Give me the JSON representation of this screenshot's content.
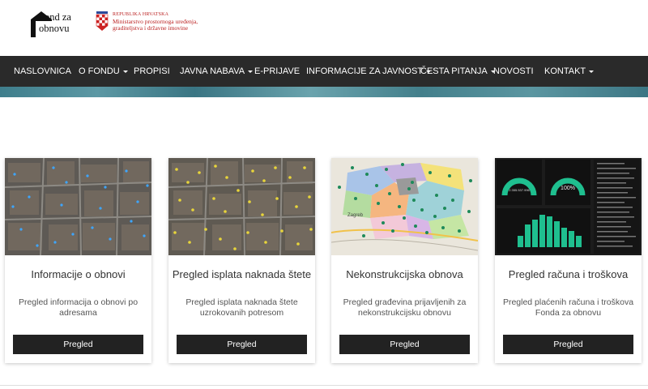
{
  "header": {
    "logo_line1": "Fond za",
    "logo_line2": "obnovu",
    "ministry_line1": "REPUBLIKA HRVATSKA",
    "ministry_line2": "Ministarstvo prostornoga uređenja,",
    "ministry_line3": "graditeljstva i državne imovine"
  },
  "nav": {
    "items": [
      {
        "label": "NASLOVNICA",
        "dropdown": false
      },
      {
        "label": "O FONDU",
        "dropdown": true
      },
      {
        "label": "PROPISI",
        "dropdown": false
      },
      {
        "label": "JAVNA NABAVA",
        "dropdown": true
      },
      {
        "label": "E-PRIJAVE",
        "dropdown": false
      },
      {
        "label": "INFORMACIJE ZA JAVNOST",
        "dropdown": true
      },
      {
        "label": "ČESTA PITANJA",
        "dropdown": true
      },
      {
        "label": "NOVOSTI",
        "dropdown": false
      },
      {
        "label": "KONTAKT",
        "dropdown": true
      }
    ]
  },
  "cards": [
    {
      "title": "Informacije o obnovi",
      "desc": "Pregled informacija o obnovi po adresama",
      "button": "Pregled"
    },
    {
      "title": "Pregled isplata naknada štete",
      "desc": "Pregled isplata naknada štete uzrokovanih potresom",
      "button": "Pregled"
    },
    {
      "title": "Nekonstrukcijska obnova",
      "desc": "Pregled građevina prijavljenih za nekonstrukcijsku obnovu",
      "button": "Pregled"
    },
    {
      "title": "Pregled računa i troškova",
      "desc": "Pregled plaćenih računa i troškova Fonda za obnovu",
      "button": "Pregled"
    }
  ],
  "dashboard": {
    "gauge_left": "2.355.537.996",
    "gauge_right": "100%"
  },
  "map_label": "Zagreb",
  "colors": {
    "nav_bg": "#2a2a2a",
    "button_bg": "#222222",
    "dashboard_accent": "#1fbf8f"
  }
}
